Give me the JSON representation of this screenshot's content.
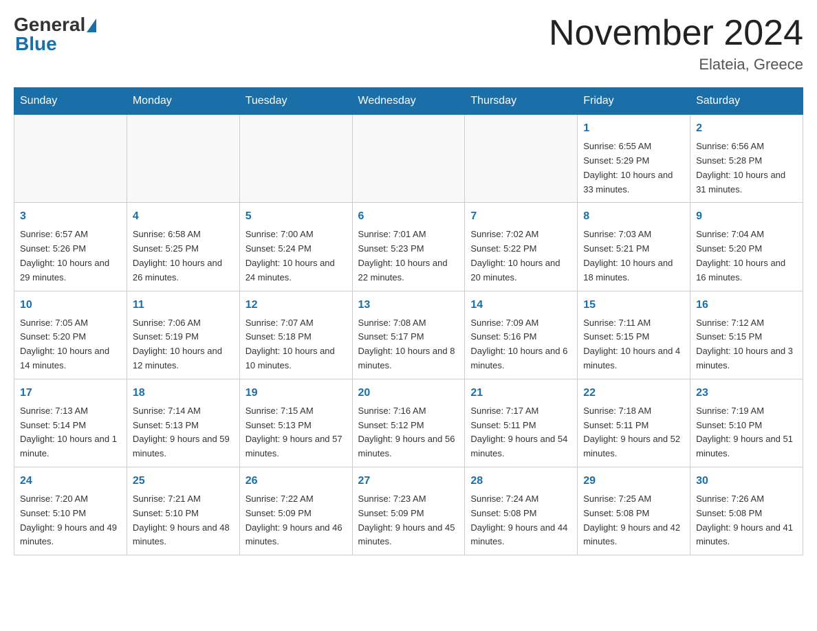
{
  "header": {
    "logo_general": "General",
    "logo_blue": "Blue",
    "title": "November 2024",
    "subtitle": "Elateia, Greece"
  },
  "weekdays": [
    "Sunday",
    "Monday",
    "Tuesday",
    "Wednesday",
    "Thursday",
    "Friday",
    "Saturday"
  ],
  "weeks": [
    [
      {
        "day": "",
        "sunrise": "",
        "sunset": "",
        "daylight": ""
      },
      {
        "day": "",
        "sunrise": "",
        "sunset": "",
        "daylight": ""
      },
      {
        "day": "",
        "sunrise": "",
        "sunset": "",
        "daylight": ""
      },
      {
        "day": "",
        "sunrise": "",
        "sunset": "",
        "daylight": ""
      },
      {
        "day": "",
        "sunrise": "",
        "sunset": "",
        "daylight": ""
      },
      {
        "day": "1",
        "sunrise": "Sunrise: 6:55 AM",
        "sunset": "Sunset: 5:29 PM",
        "daylight": "Daylight: 10 hours and 33 minutes."
      },
      {
        "day": "2",
        "sunrise": "Sunrise: 6:56 AM",
        "sunset": "Sunset: 5:28 PM",
        "daylight": "Daylight: 10 hours and 31 minutes."
      }
    ],
    [
      {
        "day": "3",
        "sunrise": "Sunrise: 6:57 AM",
        "sunset": "Sunset: 5:26 PM",
        "daylight": "Daylight: 10 hours and 29 minutes."
      },
      {
        "day": "4",
        "sunrise": "Sunrise: 6:58 AM",
        "sunset": "Sunset: 5:25 PM",
        "daylight": "Daylight: 10 hours and 26 minutes."
      },
      {
        "day": "5",
        "sunrise": "Sunrise: 7:00 AM",
        "sunset": "Sunset: 5:24 PM",
        "daylight": "Daylight: 10 hours and 24 minutes."
      },
      {
        "day": "6",
        "sunrise": "Sunrise: 7:01 AM",
        "sunset": "Sunset: 5:23 PM",
        "daylight": "Daylight: 10 hours and 22 minutes."
      },
      {
        "day": "7",
        "sunrise": "Sunrise: 7:02 AM",
        "sunset": "Sunset: 5:22 PM",
        "daylight": "Daylight: 10 hours and 20 minutes."
      },
      {
        "day": "8",
        "sunrise": "Sunrise: 7:03 AM",
        "sunset": "Sunset: 5:21 PM",
        "daylight": "Daylight: 10 hours and 18 minutes."
      },
      {
        "day": "9",
        "sunrise": "Sunrise: 7:04 AM",
        "sunset": "Sunset: 5:20 PM",
        "daylight": "Daylight: 10 hours and 16 minutes."
      }
    ],
    [
      {
        "day": "10",
        "sunrise": "Sunrise: 7:05 AM",
        "sunset": "Sunset: 5:20 PM",
        "daylight": "Daylight: 10 hours and 14 minutes."
      },
      {
        "day": "11",
        "sunrise": "Sunrise: 7:06 AM",
        "sunset": "Sunset: 5:19 PM",
        "daylight": "Daylight: 10 hours and 12 minutes."
      },
      {
        "day": "12",
        "sunrise": "Sunrise: 7:07 AM",
        "sunset": "Sunset: 5:18 PM",
        "daylight": "Daylight: 10 hours and 10 minutes."
      },
      {
        "day": "13",
        "sunrise": "Sunrise: 7:08 AM",
        "sunset": "Sunset: 5:17 PM",
        "daylight": "Daylight: 10 hours and 8 minutes."
      },
      {
        "day": "14",
        "sunrise": "Sunrise: 7:09 AM",
        "sunset": "Sunset: 5:16 PM",
        "daylight": "Daylight: 10 hours and 6 minutes."
      },
      {
        "day": "15",
        "sunrise": "Sunrise: 7:11 AM",
        "sunset": "Sunset: 5:15 PM",
        "daylight": "Daylight: 10 hours and 4 minutes."
      },
      {
        "day": "16",
        "sunrise": "Sunrise: 7:12 AM",
        "sunset": "Sunset: 5:15 PM",
        "daylight": "Daylight: 10 hours and 3 minutes."
      }
    ],
    [
      {
        "day": "17",
        "sunrise": "Sunrise: 7:13 AM",
        "sunset": "Sunset: 5:14 PM",
        "daylight": "Daylight: 10 hours and 1 minute."
      },
      {
        "day": "18",
        "sunrise": "Sunrise: 7:14 AM",
        "sunset": "Sunset: 5:13 PM",
        "daylight": "Daylight: 9 hours and 59 minutes."
      },
      {
        "day": "19",
        "sunrise": "Sunrise: 7:15 AM",
        "sunset": "Sunset: 5:13 PM",
        "daylight": "Daylight: 9 hours and 57 minutes."
      },
      {
        "day": "20",
        "sunrise": "Sunrise: 7:16 AM",
        "sunset": "Sunset: 5:12 PM",
        "daylight": "Daylight: 9 hours and 56 minutes."
      },
      {
        "day": "21",
        "sunrise": "Sunrise: 7:17 AM",
        "sunset": "Sunset: 5:11 PM",
        "daylight": "Daylight: 9 hours and 54 minutes."
      },
      {
        "day": "22",
        "sunrise": "Sunrise: 7:18 AM",
        "sunset": "Sunset: 5:11 PM",
        "daylight": "Daylight: 9 hours and 52 minutes."
      },
      {
        "day": "23",
        "sunrise": "Sunrise: 7:19 AM",
        "sunset": "Sunset: 5:10 PM",
        "daylight": "Daylight: 9 hours and 51 minutes."
      }
    ],
    [
      {
        "day": "24",
        "sunrise": "Sunrise: 7:20 AM",
        "sunset": "Sunset: 5:10 PM",
        "daylight": "Daylight: 9 hours and 49 minutes."
      },
      {
        "day": "25",
        "sunrise": "Sunrise: 7:21 AM",
        "sunset": "Sunset: 5:10 PM",
        "daylight": "Daylight: 9 hours and 48 minutes."
      },
      {
        "day": "26",
        "sunrise": "Sunrise: 7:22 AM",
        "sunset": "Sunset: 5:09 PM",
        "daylight": "Daylight: 9 hours and 46 minutes."
      },
      {
        "day": "27",
        "sunrise": "Sunrise: 7:23 AM",
        "sunset": "Sunset: 5:09 PM",
        "daylight": "Daylight: 9 hours and 45 minutes."
      },
      {
        "day": "28",
        "sunrise": "Sunrise: 7:24 AM",
        "sunset": "Sunset: 5:08 PM",
        "daylight": "Daylight: 9 hours and 44 minutes."
      },
      {
        "day": "29",
        "sunrise": "Sunrise: 7:25 AM",
        "sunset": "Sunset: 5:08 PM",
        "daylight": "Daylight: 9 hours and 42 minutes."
      },
      {
        "day": "30",
        "sunrise": "Sunrise: 7:26 AM",
        "sunset": "Sunset: 5:08 PM",
        "daylight": "Daylight: 9 hours and 41 minutes."
      }
    ]
  ]
}
